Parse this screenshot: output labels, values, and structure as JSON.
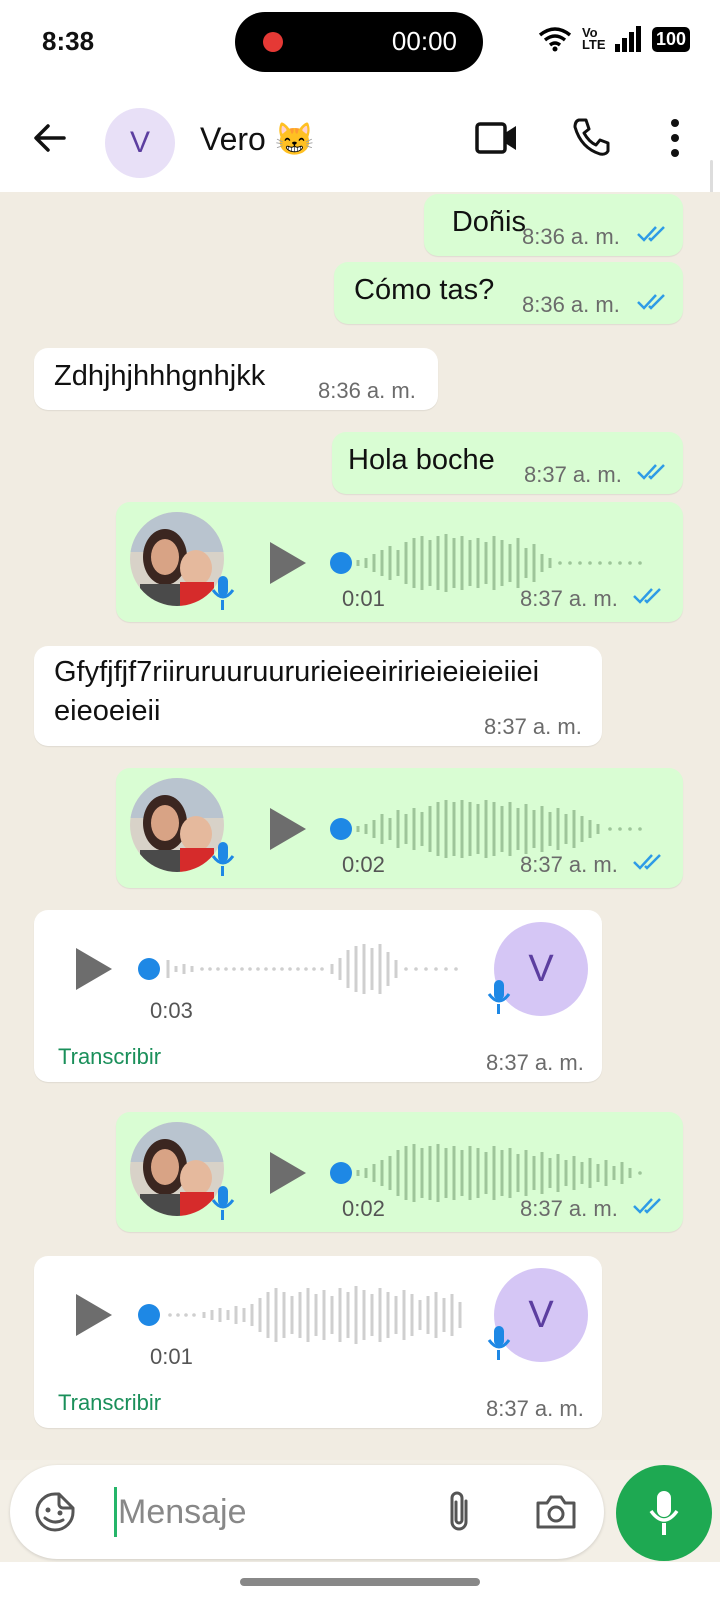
{
  "status_bar": {
    "time": "8:38",
    "recording_timer": "00:00",
    "volte": "Vo LTE",
    "battery": "100"
  },
  "header": {
    "avatar_letter": "V",
    "contact_name": "Vero 😸"
  },
  "messages": [
    {
      "type": "text",
      "direction": "out",
      "text": "Doñis",
      "time": "8:36 a. m.",
      "read": true
    },
    {
      "type": "text",
      "direction": "out",
      "text": "Cómo tas?",
      "time": "8:36 a. m.",
      "read": true
    },
    {
      "type": "text",
      "direction": "in",
      "text": "Zdhjhjhhhgnhjkk",
      "time": "8:36 a. m."
    },
    {
      "type": "text",
      "direction": "out",
      "text": "Hola boche",
      "time": "8:37 a. m.",
      "read": true
    },
    {
      "type": "voice",
      "direction": "out",
      "duration": "0:01",
      "time": "8:37 a. m.",
      "read": true
    },
    {
      "type": "text",
      "direction": "in",
      "text_line1": "Gfyfjfjf7riiruruuruururieieeiririeieieieiiei",
      "text_line2": "eieoeieii",
      "time": "8:37 a. m."
    },
    {
      "type": "voice",
      "direction": "out",
      "duration": "0:02",
      "time": "8:37 a. m.",
      "read": true
    },
    {
      "type": "voice",
      "direction": "in",
      "duration": "0:03",
      "time": "8:37 a. m.",
      "transcribe": "Transcribir",
      "avatar_letter": "V"
    },
    {
      "type": "voice",
      "direction": "out",
      "duration": "0:02",
      "time": "8:37 a. m.",
      "read": true
    },
    {
      "type": "voice",
      "direction": "in",
      "duration": "0:01",
      "time": "8:37 a. m.",
      "transcribe": "Transcribir",
      "avatar_letter": "V"
    }
  ],
  "composer": {
    "placeholder": "Mensaje"
  },
  "colors": {
    "outgoing": "#d9fdd3",
    "incoming": "#ffffff",
    "accent_green": "#1ea952",
    "read_ticks": "#2e9be6",
    "seek_dot": "#1e88e5"
  },
  "icons": [
    "back-arrow-icon",
    "video-call-icon",
    "phone-icon",
    "more-vert-icon",
    "wifi-icon",
    "signal-icon",
    "play-icon",
    "mic-icon",
    "sticker-icon",
    "attach-icon",
    "camera-icon"
  ]
}
